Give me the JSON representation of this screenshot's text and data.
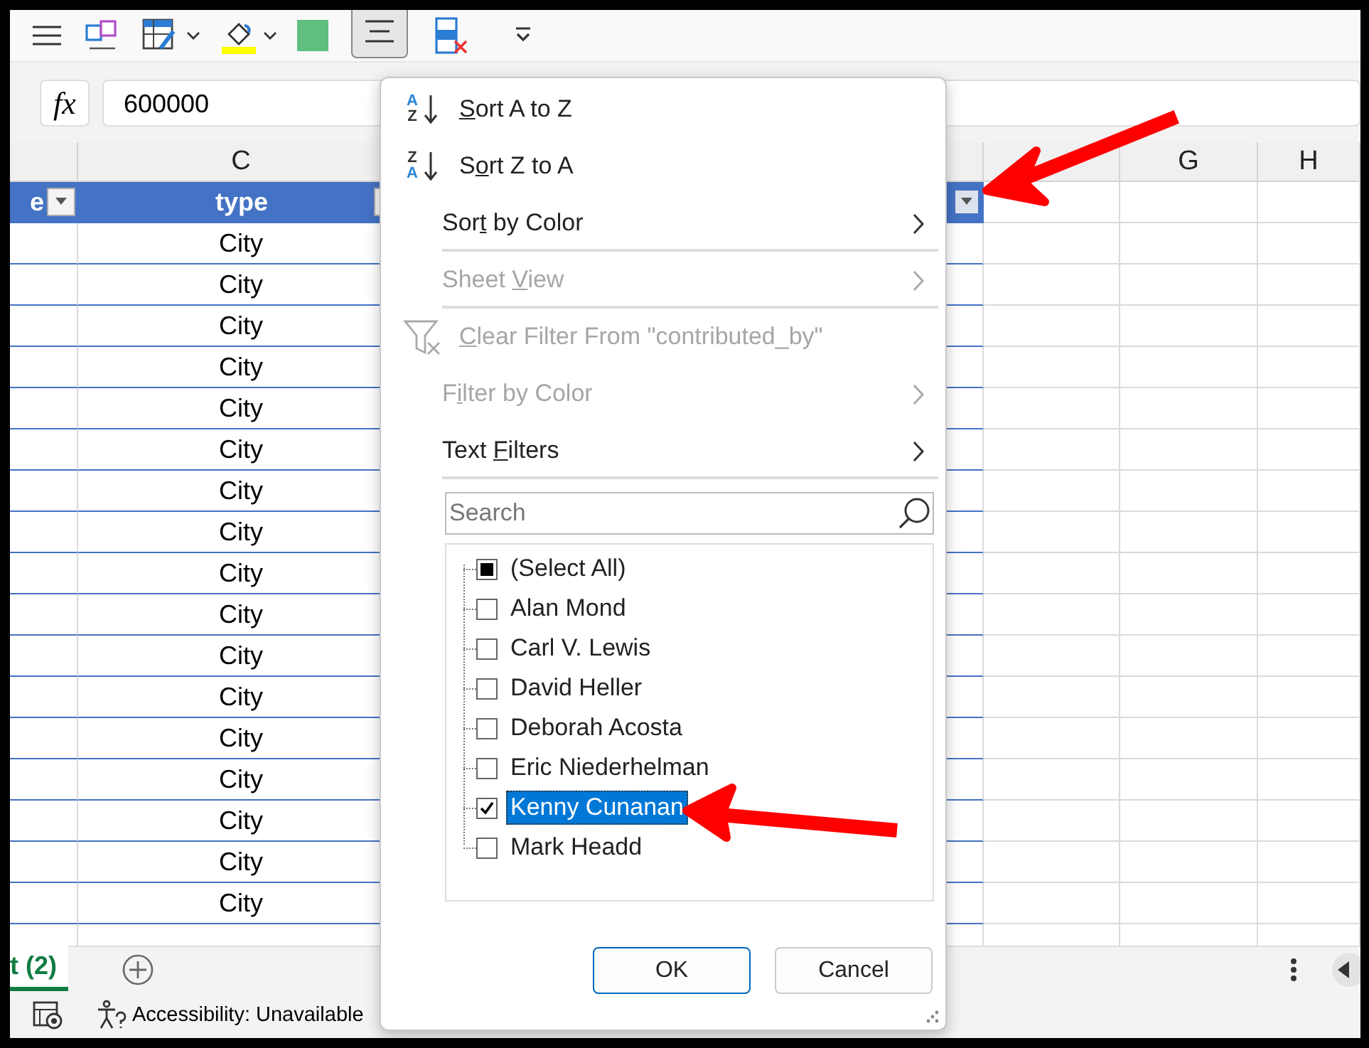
{
  "formula_bar": {
    "function_label": "fx",
    "value": "600000"
  },
  "column_headers": [
    {
      "label": "C"
    },
    {
      "label": "G"
    },
    {
      "label": "H"
    }
  ],
  "table_header": [
    {
      "text": "e",
      "filter_button": true,
      "filter_active": false
    },
    {
      "text": "type",
      "filter_button": true,
      "filter_active": false
    },
    {
      "filter_button": true,
      "filter_active": true
    }
  ],
  "rows": [
    {
      "type": "City"
    },
    {
      "type": "City"
    },
    {
      "type": "City"
    },
    {
      "type": "City"
    },
    {
      "type": "City"
    },
    {
      "type": "City"
    },
    {
      "type": "City"
    },
    {
      "type": "City"
    },
    {
      "type": "City"
    },
    {
      "type": "City"
    },
    {
      "type": "City"
    },
    {
      "type": "City"
    },
    {
      "type": "City"
    },
    {
      "type": "City"
    },
    {
      "type": "City"
    },
    {
      "type": "City"
    },
    {
      "type": "City"
    }
  ],
  "sheet_tabs": [
    {
      "label": "t (2)",
      "selected": true
    }
  ],
  "status_bar": {
    "accessibility": "Accessibility: Unavailable"
  },
  "filter_menu": {
    "items": [
      {
        "kind": "sort_asc",
        "icon_letters": [
          "A",
          "Z"
        ],
        "key": "S",
        "post": "ort A to Z",
        "disabled": false,
        "submenu": false,
        "divider_after": false
      },
      {
        "kind": "sort_desc",
        "icon_letters": [
          "Z",
          "A"
        ],
        "pre": "S",
        "key": "o",
        "post": "rt Z to A",
        "disabled": false,
        "submenu": false,
        "divider_after": false
      },
      {
        "kind": "plain",
        "pre": "Sor",
        "key": "t",
        "post": " by Color",
        "disabled": false,
        "submenu": true,
        "divider_after": true
      },
      {
        "kind": "plain",
        "pre": "Sheet ",
        "key": "V",
        "post": "iew",
        "disabled": true,
        "submenu": true,
        "divider_after": true
      },
      {
        "kind": "clear_filter",
        "key": "C",
        "post": "lear Filter From \"contributed_by\"",
        "disabled": true,
        "submenu": false,
        "divider_after": false
      },
      {
        "kind": "plain",
        "pre": "F",
        "key": "i",
        "post": "lter by Color",
        "disabled": true,
        "submenu": true,
        "divider_after": false
      },
      {
        "kind": "plain",
        "pre": "Text ",
        "key": "F",
        "post": "ilters",
        "disabled": false,
        "submenu": true,
        "divider_after": true
      }
    ],
    "search": {
      "placeholder": "Search"
    },
    "values": [
      {
        "label": "(Select All)",
        "checked": false,
        "partial": true,
        "selected": false
      },
      {
        "label": "Alan Mond",
        "checked": false,
        "partial": false,
        "selected": false
      },
      {
        "label": "Carl V. Lewis",
        "checked": false,
        "partial": false,
        "selected": false
      },
      {
        "label": "David Heller",
        "checked": false,
        "partial": false,
        "selected": false
      },
      {
        "label": "Deborah Acosta",
        "checked": false,
        "partial": false,
        "selected": false
      },
      {
        "label": "Eric Niederhelman",
        "checked": false,
        "partial": false,
        "selected": false
      },
      {
        "label": "Kenny Cunanan",
        "checked": true,
        "partial": false,
        "selected": true
      },
      {
        "label": "Mark Headd",
        "checked": false,
        "partial": false,
        "selected": false
      }
    ],
    "buttons": [
      {
        "label": "OK",
        "focused": true
      },
      {
        "label": "Cancel",
        "focused": false
      }
    ]
  }
}
